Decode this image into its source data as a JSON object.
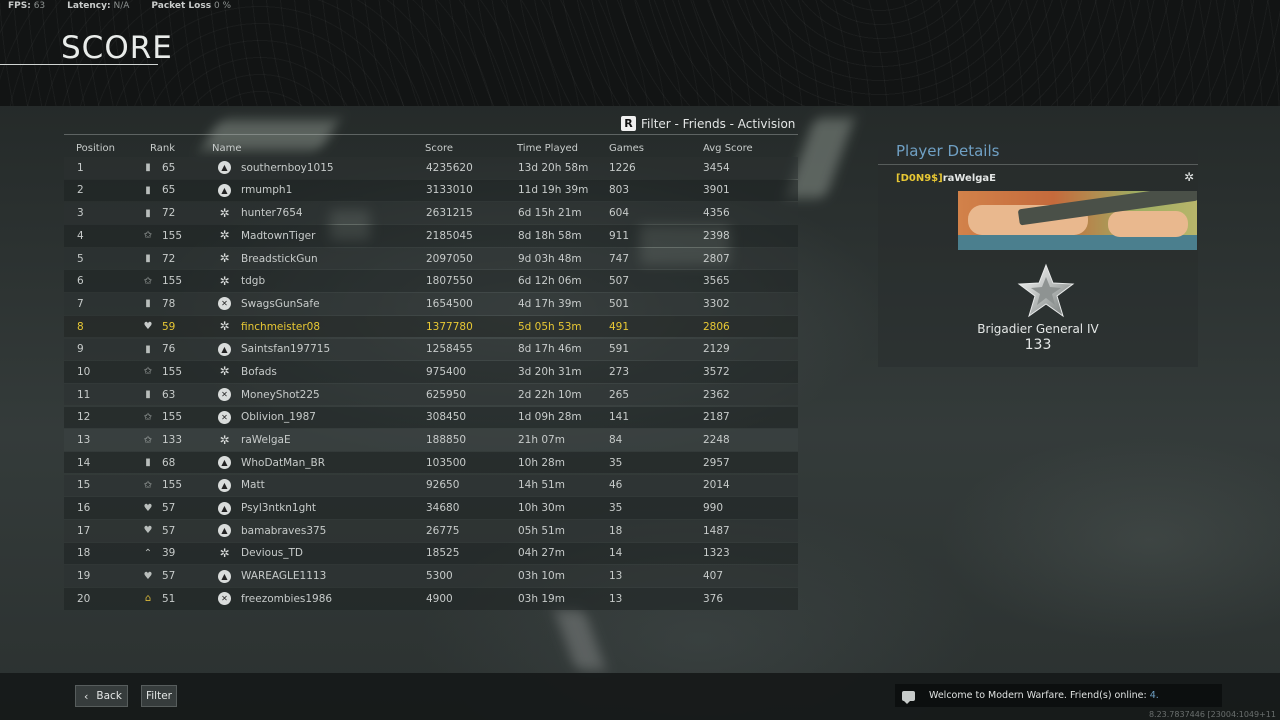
{
  "stats": {
    "fps_label": "FPS:",
    "fps_value": "63",
    "latency_label": "Latency:",
    "latency_value": "N/A",
    "packet_loss_label": "Packet Loss",
    "packet_loss_value": "0 %"
  },
  "page_title": "SCORE",
  "filter": {
    "key": "R",
    "label": "Filter - Friends - Activision"
  },
  "columns": {
    "position": "Position",
    "rank": "Rank",
    "name": "Name",
    "score": "Score",
    "time_played": "Time Played",
    "games": "Games",
    "avg_score": "Avg Score"
  },
  "rows": [
    {
      "position": "1",
      "rank": "65",
      "rank_icon": "bar-rank-icon",
      "platform": "playstation",
      "name": "southernboy1015",
      "score": "4235620",
      "time": "13d 20h 58m",
      "games": "1226",
      "avg": "3454"
    },
    {
      "position": "2",
      "rank": "65",
      "rank_icon": "bar-rank-icon",
      "platform": "playstation",
      "name": "rmumph1",
      "score": "3133010",
      "time": "11d 19h 39m",
      "games": "803",
      "avg": "3901"
    },
    {
      "position": "3",
      "rank": "72",
      "rank_icon": "bar-rank-icon",
      "platform": "battlenet",
      "name": "hunter7654",
      "score": "2631215",
      "time": "6d 15h 21m",
      "games": "604",
      "avg": "4356"
    },
    {
      "position": "4",
      "rank": "155",
      "rank_icon": "star-rank-icon",
      "platform": "battlenet",
      "name": "MadtownTiger",
      "score": "2185045",
      "time": "8d 18h 58m",
      "games": "911",
      "avg": "2398"
    },
    {
      "position": "5",
      "rank": "72",
      "rank_icon": "bar-rank-icon",
      "platform": "battlenet",
      "name": "BreadstickGun",
      "score": "2097050",
      "time": "9d 03h 48m",
      "games": "747",
      "avg": "2807"
    },
    {
      "position": "6",
      "rank": "155",
      "rank_icon": "star-rank-icon",
      "platform": "battlenet",
      "name": "tdgb",
      "score": "1807550",
      "time": "6d 12h 06m",
      "games": "507",
      "avg": "3565"
    },
    {
      "position": "7",
      "rank": "78",
      "rank_icon": "bar-rank-icon",
      "platform": "xbox",
      "name": "SwagsGunSafe",
      "score": "1654500",
      "time": "4d 17h 39m",
      "games": "501",
      "avg": "3302"
    },
    {
      "position": "8",
      "rank": "59",
      "rank_icon": "wing-rank-icon",
      "platform": "battlenet",
      "name": "finchmeister08",
      "score": "1377780",
      "time": "5d 05h 53m",
      "games": "491",
      "avg": "2806",
      "highlight": true
    },
    {
      "position": "9",
      "rank": "76",
      "rank_icon": "bar-rank-icon",
      "platform": "playstation",
      "name": "Saintsfan197715",
      "score": "1258455",
      "time": "8d 17h 46m",
      "games": "591",
      "avg": "2129"
    },
    {
      "position": "10",
      "rank": "155",
      "rank_icon": "star-rank-icon",
      "platform": "battlenet",
      "name": "Bofads",
      "score": "975400",
      "time": "3d 20h 31m",
      "games": "273",
      "avg": "3572"
    },
    {
      "position": "11",
      "rank": "63",
      "rank_icon": "bar-rank-icon",
      "platform": "xbox",
      "name": "MoneyShot225",
      "score": "625950",
      "time": "2d 22h 10m",
      "games": "265",
      "avg": "2362"
    },
    {
      "position": "12",
      "rank": "155",
      "rank_icon": "star-rank-icon",
      "platform": "xbox",
      "name": "Oblivion_1987",
      "score": "308450",
      "time": "1d 09h 28m",
      "games": "141",
      "avg": "2187"
    },
    {
      "position": "13",
      "rank": "133",
      "rank_icon": "star-rank-icon",
      "platform": "battlenet",
      "name": "raWelgaE",
      "score": "188850",
      "time": "21h 07m",
      "games": "84",
      "avg": "2248",
      "selected": true
    },
    {
      "position": "14",
      "rank": "68",
      "rank_icon": "bar-rank-icon",
      "platform": "playstation",
      "name": "WhoDatMan_BR",
      "score": "103500",
      "time": "10h 28m",
      "games": "35",
      "avg": "2957"
    },
    {
      "position": "15",
      "rank": "155",
      "rank_icon": "star-rank-icon",
      "platform": "playstation",
      "name": "Matt",
      "score": "92650",
      "time": "14h 51m",
      "games": "46",
      "avg": "2014"
    },
    {
      "position": "16",
      "rank": "57",
      "rank_icon": "wing-rank-icon",
      "platform": "playstation",
      "name": "Psyl3ntkn1ght",
      "score": "34680",
      "time": "10h 30m",
      "games": "35",
      "avg": "990"
    },
    {
      "position": "17",
      "rank": "57",
      "rank_icon": "wing-rank-icon",
      "platform": "playstation",
      "name": "bamabraves375",
      "score": "26775",
      "time": "05h 51m",
      "games": "18",
      "avg": "1487"
    },
    {
      "position": "18",
      "rank": "39",
      "rank_icon": "chevron-rank-icon",
      "platform": "battlenet",
      "name": "Devious_TD",
      "score": "18525",
      "time": "04h 27m",
      "games": "14",
      "avg": "1323"
    },
    {
      "position": "19",
      "rank": "57",
      "rank_icon": "wing-rank-icon",
      "platform": "playstation",
      "name": "WAREAGLE1113",
      "score": "5300",
      "time": "03h 10m",
      "games": "13",
      "avg": "407"
    },
    {
      "position": "20",
      "rank": "51",
      "rank_icon": "gold-chevron-rank-icon",
      "platform": "xbox",
      "name": "freezombies1986",
      "score": "4900",
      "time": "03h 19m",
      "games": "13",
      "avg": "376"
    }
  ],
  "details": {
    "title": "Player Details",
    "clan_tag": "[D0N9$]",
    "gamertag": "raWelgaE",
    "rank_title": "Brigadier General IV",
    "rank_level": "133"
  },
  "buttons": {
    "back": "Back",
    "filter": "Filter"
  },
  "chat": {
    "message": "Welcome to Modern Warfare. Friend(s) online:",
    "friends_online": "4."
  },
  "build": "8.23.7837446 [23004:1049+11"
}
